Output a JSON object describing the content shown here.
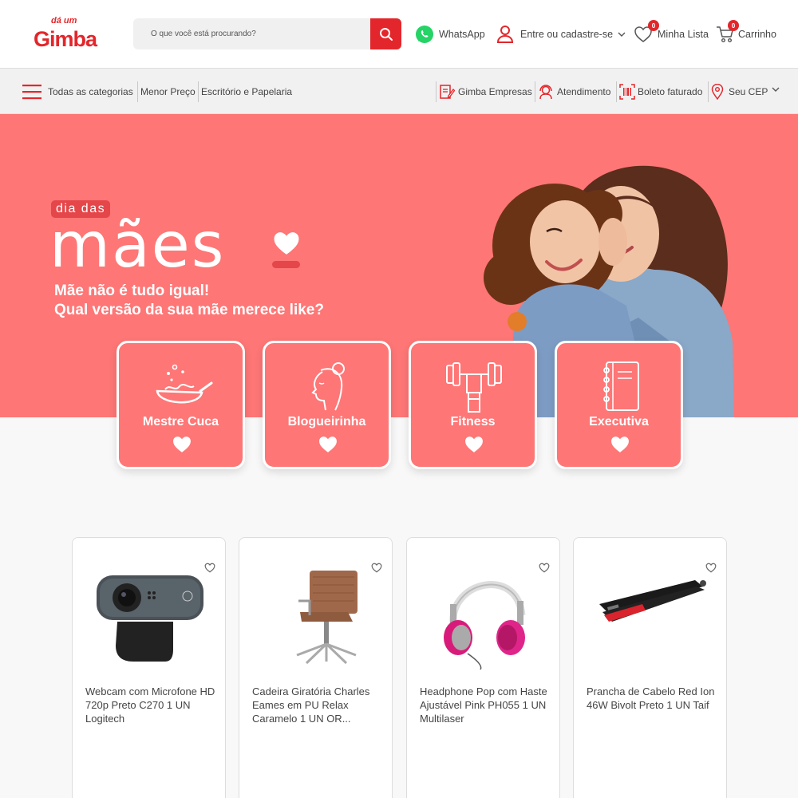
{
  "header": {
    "logo_small": "dá um",
    "logo_big": "Gimba",
    "search_placeholder": "O que você está procurando?",
    "whatsapp_label": "WhatsApp",
    "account_label": "Entre ou cadastre-se",
    "wishlist_label": "Minha Lista",
    "wishlist_count": "0",
    "cart_label": "Carrinho",
    "cart_count": "0"
  },
  "nav": {
    "all_categories": "Todas as categorias",
    "lowest_price": "Menor Preço",
    "office": "Escritório e Papelaria",
    "business": "Gimba Empresas",
    "support": "Atendimento",
    "invoice": "Boleto faturado",
    "zip": "Seu CEP"
  },
  "hero": {
    "kicker": "dia das",
    "title": "mães",
    "subtitle_line1": "Mãe não é tudo igual!",
    "subtitle_line2": "Qual versão da sua mãe merece like?",
    "categories": [
      {
        "label": "Mestre Cuca",
        "icon": "wok-icon"
      },
      {
        "label": "Blogueirinha",
        "icon": "woman-profile-icon"
      },
      {
        "label": "Fitness",
        "icon": "dumbbell-icon"
      },
      {
        "label": "Executiva",
        "icon": "notebook-icon"
      }
    ]
  },
  "products": [
    {
      "name": "Webcam com Microfone HD 720p Preto C270 1 UN Logitech"
    },
    {
      "name": "Cadeira Giratória Charles Eames em PU Relax Caramelo 1 UN OR..."
    },
    {
      "name": "Headphone Pop com Haste Ajustável Pink PH055 1 UN Multilaser"
    },
    {
      "name": "Prancha de Cabelo Red Ion 46W Bivolt Preto 1 UN Taif"
    }
  ],
  "colors": {
    "brand_red": "#e3262b",
    "hero_coral": "#fe7676"
  }
}
